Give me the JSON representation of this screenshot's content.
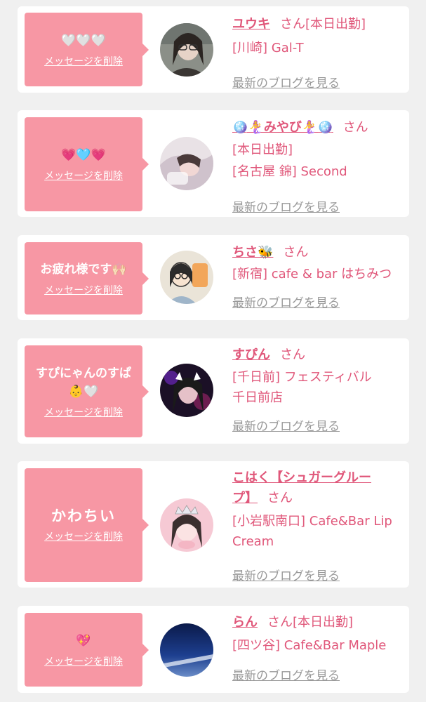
{
  "cards": [
    {
      "message": "🤍🤍🤍",
      "delete_label": "メッセージを削除",
      "name": "ユウキ",
      "honorific": "さん",
      "status": "[本日出勤]",
      "shop": "[川崎] Gal-T",
      "blog_link": "最新のブログを見る"
    },
    {
      "message": "💗🩵💗",
      "delete_label": "メッセージを削除",
      "name": "🪩🧜‍♀️みやび🧜‍♀️🪩",
      "honorific": "さん",
      "status": "[本日出勤]",
      "shop": "[名古屋 錦] Second",
      "blog_link": "最新のブログを見る"
    },
    {
      "message": "お疲れ様です🙌🏻",
      "delete_label": "メッセージを削除",
      "name": "ちさ🐝",
      "honorific": "さん",
      "shop": "[新宿] cafe & bar はちみつ",
      "blog_link": "最新のブログを見る"
    },
    {
      "message_line1": "すぴにゃんのすぱ",
      "message_line2": "👶🤍",
      "delete_label": "メッセージを削除",
      "name": "すぴん",
      "honorific": "さん",
      "shop_line1": "[千日前] フェスティバル",
      "shop_line2": "千日前店",
      "blog_link": "最新のブログを見る"
    },
    {
      "message": "かわちい",
      "delete_label": "メッセージを削除",
      "name_line1": "こはく【シュガーグルー",
      "name_line2": "プ】",
      "honorific": "さん",
      "shop_line1": "[小岩駅南口] Cafe&Bar Lip",
      "shop_line2": "Cream",
      "blog_link": "最新のブログを見る"
    },
    {
      "message": "💖",
      "delete_label": "メッセージを削除",
      "name": "らん",
      "honorific": "さん",
      "status": "[本日出勤]",
      "shop": "[四ツ谷] Cafe&Bar Maple",
      "blog_link": "最新のブログを見る"
    }
  ],
  "colors": {
    "page_bg": "#f0f0f0",
    "message_bg": "#f797a4",
    "accent_text": "#e0577a",
    "link_gray": "#999999"
  }
}
